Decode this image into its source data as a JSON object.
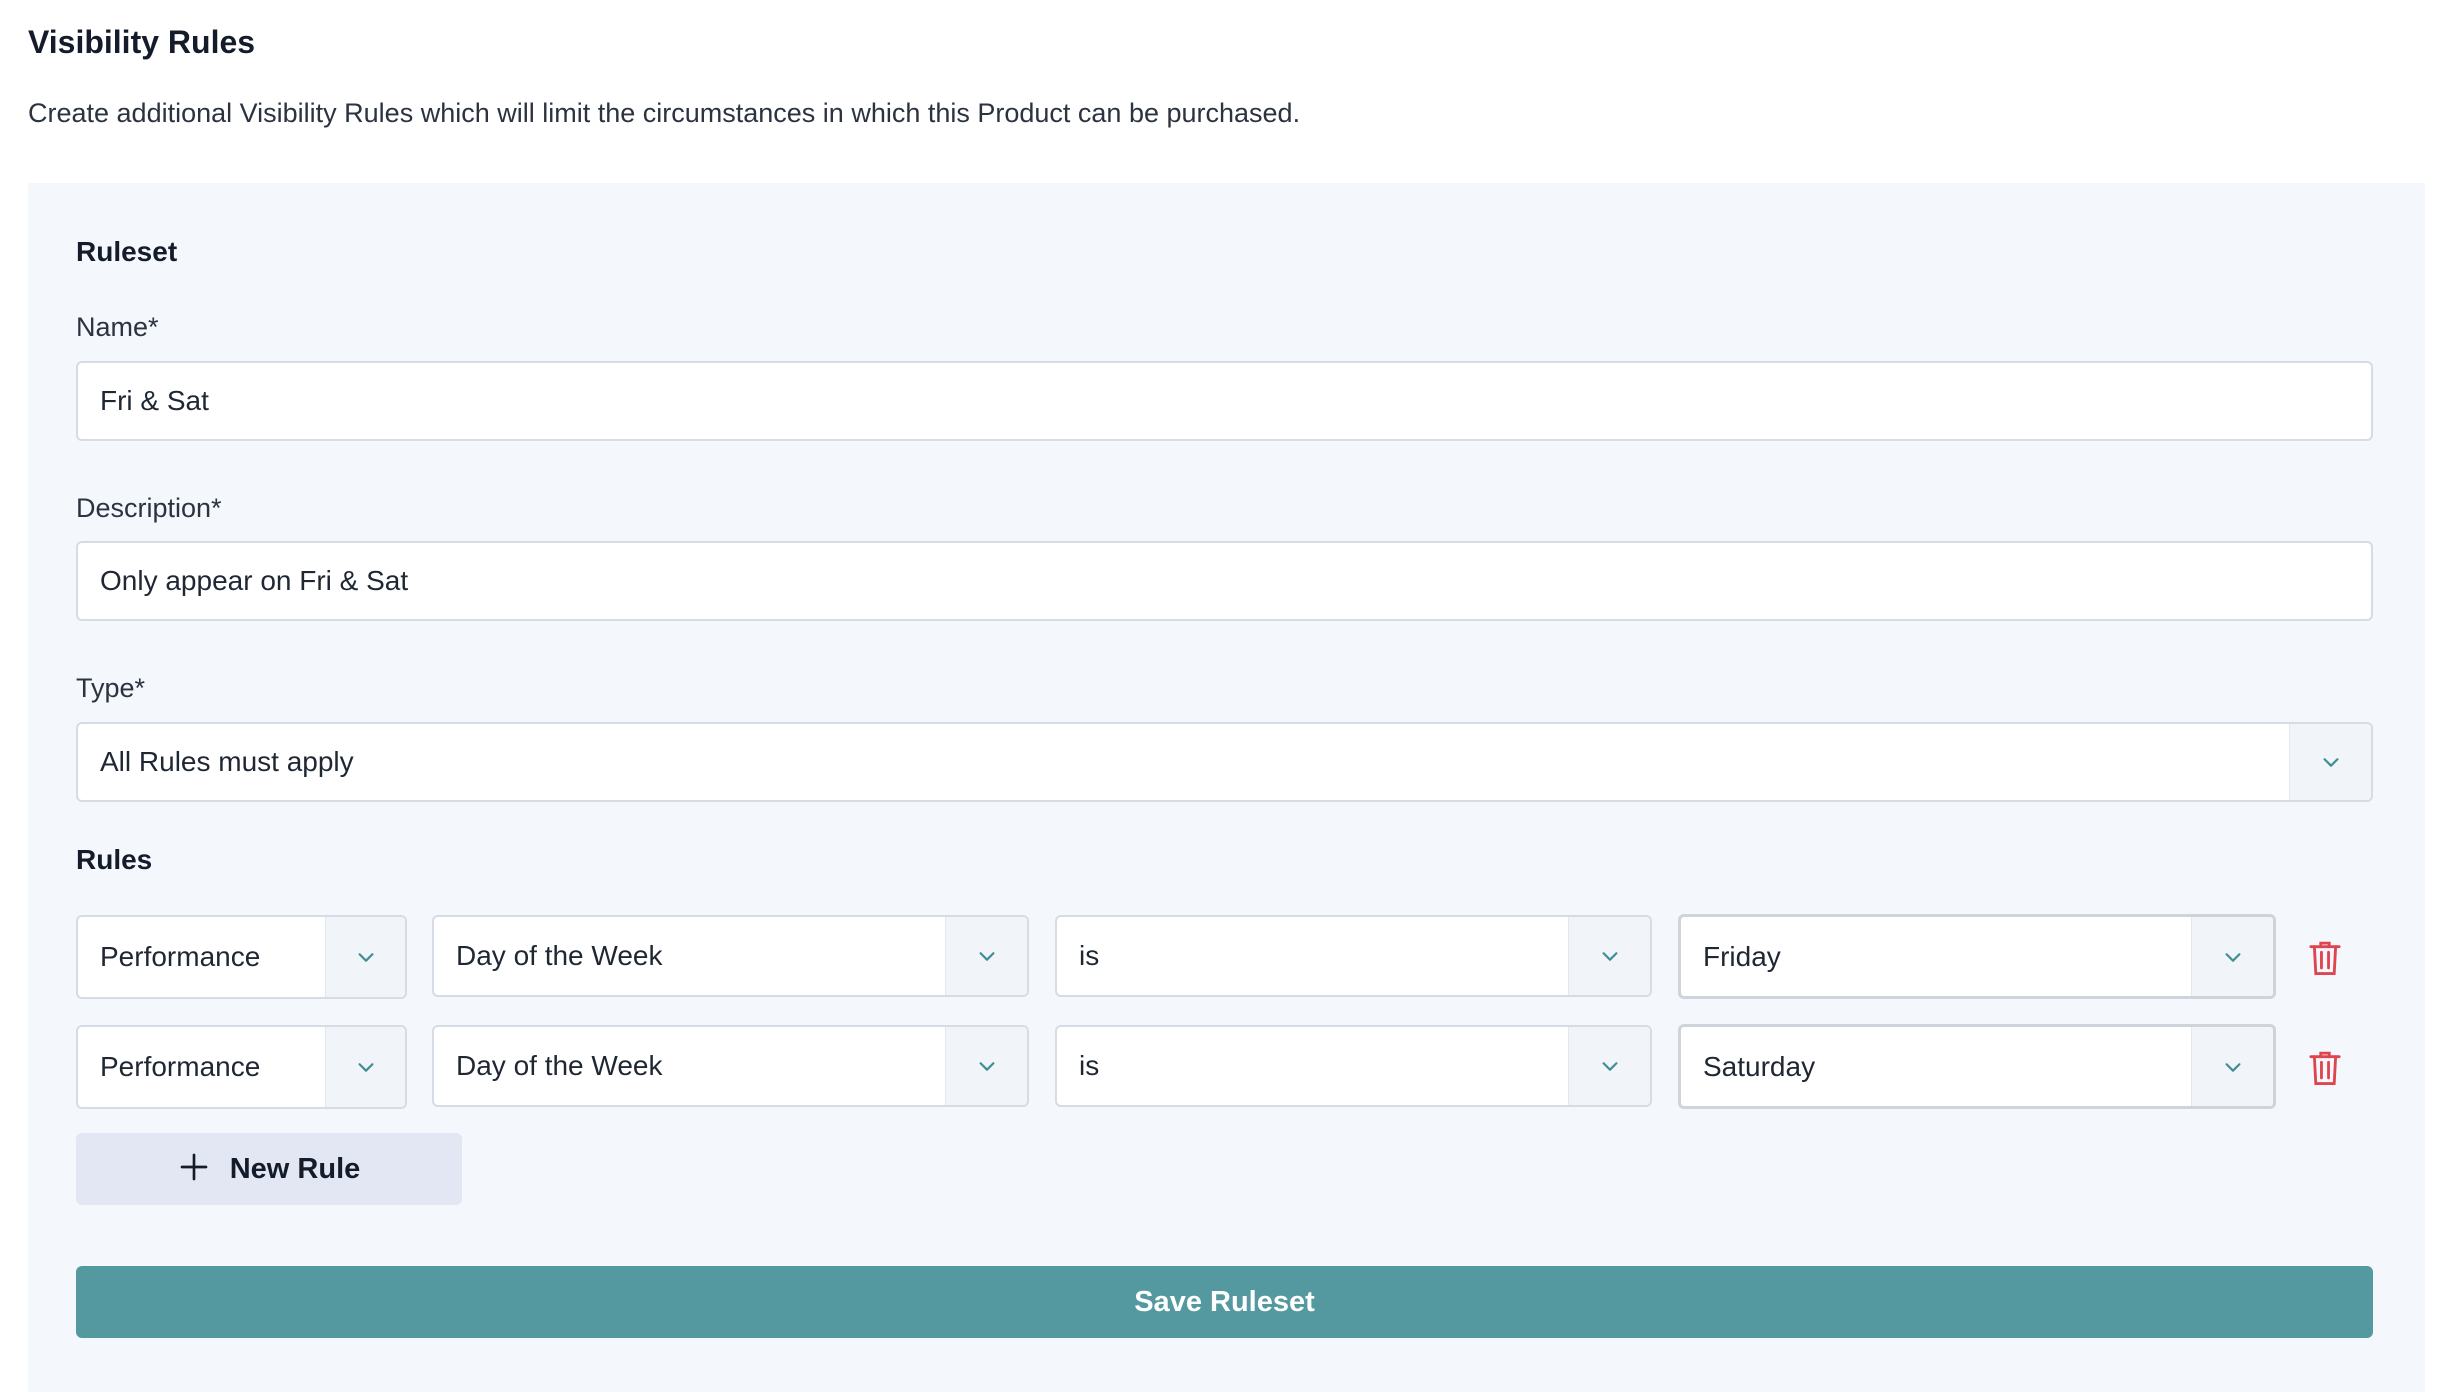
{
  "page": {
    "title": "Visibility Rules",
    "description": "Create additional Visibility Rules which will limit the circumstances in which this Product can be purchased."
  },
  "ruleset": {
    "section_title": "Ruleset",
    "name_label": "Name*",
    "name_value": "Fri & Sat",
    "description_label": "Description*",
    "description_value": "Only appear on Fri & Sat",
    "type_label": "Type*",
    "type_value": "All Rules must apply",
    "rules_title": "Rules",
    "rules": [
      {
        "scope": "Performance",
        "field": "Day of the Week",
        "operator": "is",
        "value": "Friday"
      },
      {
        "scope": "Performance",
        "field": "Day of the Week",
        "operator": "is",
        "value": "Saturday"
      }
    ],
    "new_rule_label": "New Rule",
    "save_label": "Save Ruleset"
  },
  "icons": {
    "caret": "chevron-down-icon",
    "delete": "trash-icon",
    "add": "plus-icon"
  },
  "colors": {
    "primary": "#5599a0",
    "caret": "#3f8f96",
    "danger": "#e0444e",
    "panel_bg": "#f4f7fb",
    "secondary_button": "#e2e7f3"
  }
}
